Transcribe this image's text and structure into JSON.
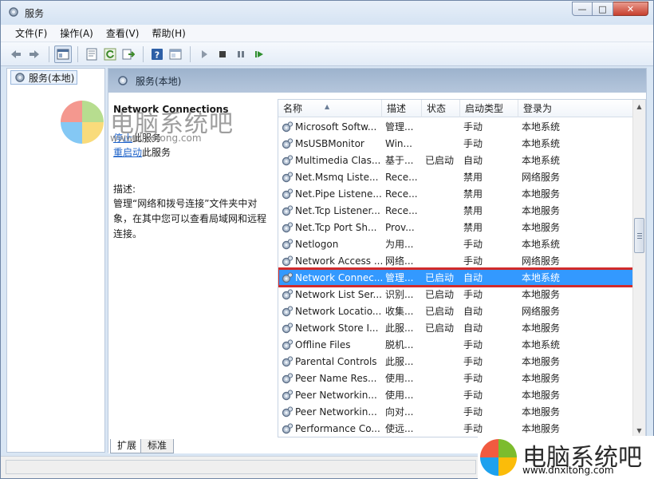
{
  "window": {
    "title": "服务",
    "min_glyph": "—",
    "max_glyph": "□",
    "close_glyph": "✕"
  },
  "menu": [
    "文件(F)",
    "操作(A)",
    "查看(V)",
    "帮助(H)"
  ],
  "toolbar": {
    "icons": [
      "back-icon",
      "forward-icon",
      "show-tree-icon",
      "properties-icon",
      "refresh-icon",
      "export-icon",
      "help-icon",
      "console-icon",
      "start-icon",
      "stop-icon",
      "pause-icon",
      "restart-icon"
    ]
  },
  "tree": {
    "root_label": "服务(本地)"
  },
  "pane": {
    "header": "服务(本地)"
  },
  "details": {
    "title": "Network Connections",
    "stop_link": "停止",
    "stop_suffix": "此服务",
    "restart_link": "重启动",
    "restart_suffix": "此服务",
    "desc_label": "描述:",
    "desc_text": "管理“网络和拨号连接”文件夹中对象，在其中您可以查看局域网和远程连接。"
  },
  "columns": [
    "名称",
    "描述",
    "状态",
    "启动类型",
    "登录为"
  ],
  "sort_indicator": "▲",
  "rows": [
    {
      "name": "Microsoft Softw...",
      "desc": "管理...",
      "status": "",
      "startup": "手动",
      "logon": "本地系统"
    },
    {
      "name": "MsUSBMonitor",
      "desc": "Win...",
      "status": "",
      "startup": "手动",
      "logon": "本地系统"
    },
    {
      "name": "Multimedia Clas...",
      "desc": "基于...",
      "status": "已启动",
      "startup": "自动",
      "logon": "本地系统"
    },
    {
      "name": "Net.Msmq Liste...",
      "desc": "Rece...",
      "status": "",
      "startup": "禁用",
      "logon": "网络服务"
    },
    {
      "name": "Net.Pipe Listene...",
      "desc": "Rece...",
      "status": "",
      "startup": "禁用",
      "logon": "本地服务"
    },
    {
      "name": "Net.Tcp Listener...",
      "desc": "Rece...",
      "status": "",
      "startup": "禁用",
      "logon": "本地服务"
    },
    {
      "name": "Net.Tcp Port Sh...",
      "desc": "Prov...",
      "status": "",
      "startup": "禁用",
      "logon": "本地服务"
    },
    {
      "name": "Netlogon",
      "desc": "为用...",
      "status": "",
      "startup": "手动",
      "logon": "本地系统"
    },
    {
      "name": "Network Access ...",
      "desc": "网络...",
      "status": "",
      "startup": "手动",
      "logon": "网络服务"
    },
    {
      "name": "Network Connec...",
      "desc": "管理...",
      "status": "已启动",
      "startup": "自动",
      "logon": "本地系统"
    },
    {
      "name": "Network List Ser...",
      "desc": "识别...",
      "status": "已启动",
      "startup": "手动",
      "logon": "本地服务"
    },
    {
      "name": "Network Locatio...",
      "desc": "收集...",
      "status": "已启动",
      "startup": "自动",
      "logon": "网络服务"
    },
    {
      "name": "Network Store I...",
      "desc": "此服...",
      "status": "已启动",
      "startup": "自动",
      "logon": "本地服务"
    },
    {
      "name": "Offline Files",
      "desc": "脱机...",
      "status": "",
      "startup": "手动",
      "logon": "本地系统"
    },
    {
      "name": "Parental Controls",
      "desc": "此服...",
      "status": "",
      "startup": "手动",
      "logon": "本地服务"
    },
    {
      "name": "Peer Name Res...",
      "desc": "使用...",
      "status": "",
      "startup": "手动",
      "logon": "本地服务"
    },
    {
      "name": "Peer Networkin...",
      "desc": "使用...",
      "status": "",
      "startup": "手动",
      "logon": "本地服务"
    },
    {
      "name": "Peer Networkin...",
      "desc": "向对...",
      "status": "",
      "startup": "手动",
      "logon": "本地服务"
    },
    {
      "name": "Performance Co...",
      "desc": "使远...",
      "status": "",
      "startup": "手动",
      "logon": "本地服务"
    }
  ],
  "selected_row_index": 9,
  "selected_color": "#3399ff",
  "highlight_color": "#d12b2b",
  "scroll": {
    "up_glyph": "▲",
    "down_glyph": "▼"
  },
  "tabs": [
    "扩展",
    "标准"
  ],
  "watermarks": {
    "top": {
      "text": "电脑系统吧",
      "url": "www.dnxitong.com"
    },
    "bottom": {
      "text": "电脑系统吧",
      "url": "www.dnxitong.com"
    }
  }
}
